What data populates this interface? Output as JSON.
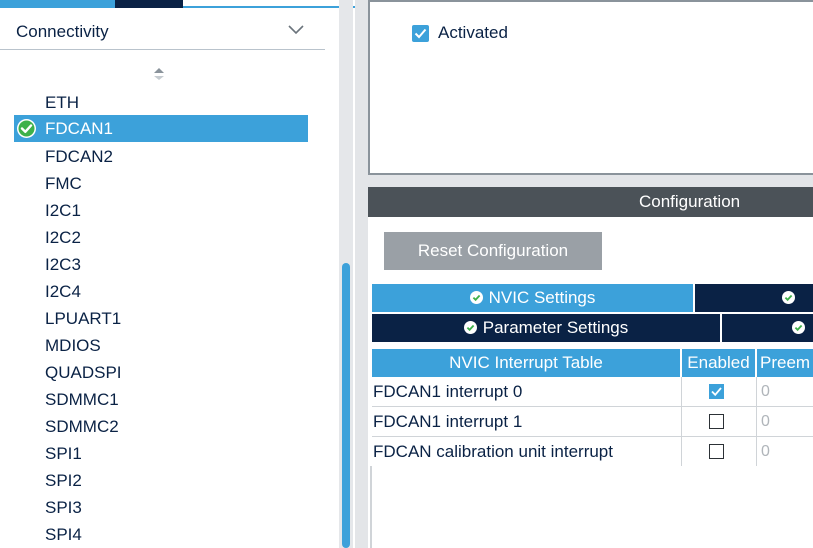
{
  "sidebar": {
    "category": "Connectivity",
    "peripherals": [
      "ETH",
      "FDCAN1",
      "FDCAN2",
      "FMC",
      "I2C1",
      "I2C2",
      "I2C3",
      "I2C4",
      "LPUART1",
      "MDIOS",
      "QUADSPI",
      "SDMMC1",
      "SDMMC2",
      "SPI1",
      "SPI2",
      "SPI3",
      "SPI4"
    ],
    "selected": "FDCAN1"
  },
  "mode": {
    "activated_label": "Activated",
    "activated": true
  },
  "config": {
    "title": "Configuration",
    "reset_label": "Reset Configuration",
    "tabs": {
      "nvic": "NVIC Settings",
      "parameter": "Parameter Settings"
    }
  },
  "table": {
    "headers": [
      "NVIC Interrupt Table",
      "Enabled",
      "Preem"
    ],
    "rows": [
      {
        "name": "FDCAN1 interrupt 0",
        "enabled": true,
        "preemption": "0"
      },
      {
        "name": "FDCAN1 interrupt 1",
        "enabled": false,
        "preemption": "0"
      },
      {
        "name": "FDCAN calibration unit interrupt",
        "enabled": false,
        "preemption": "0"
      }
    ]
  },
  "colors": {
    "accent": "#3ca1da",
    "navy": "#0a2245",
    "header_gray": "#4b5258",
    "button_gray": "#9aa0a6"
  }
}
